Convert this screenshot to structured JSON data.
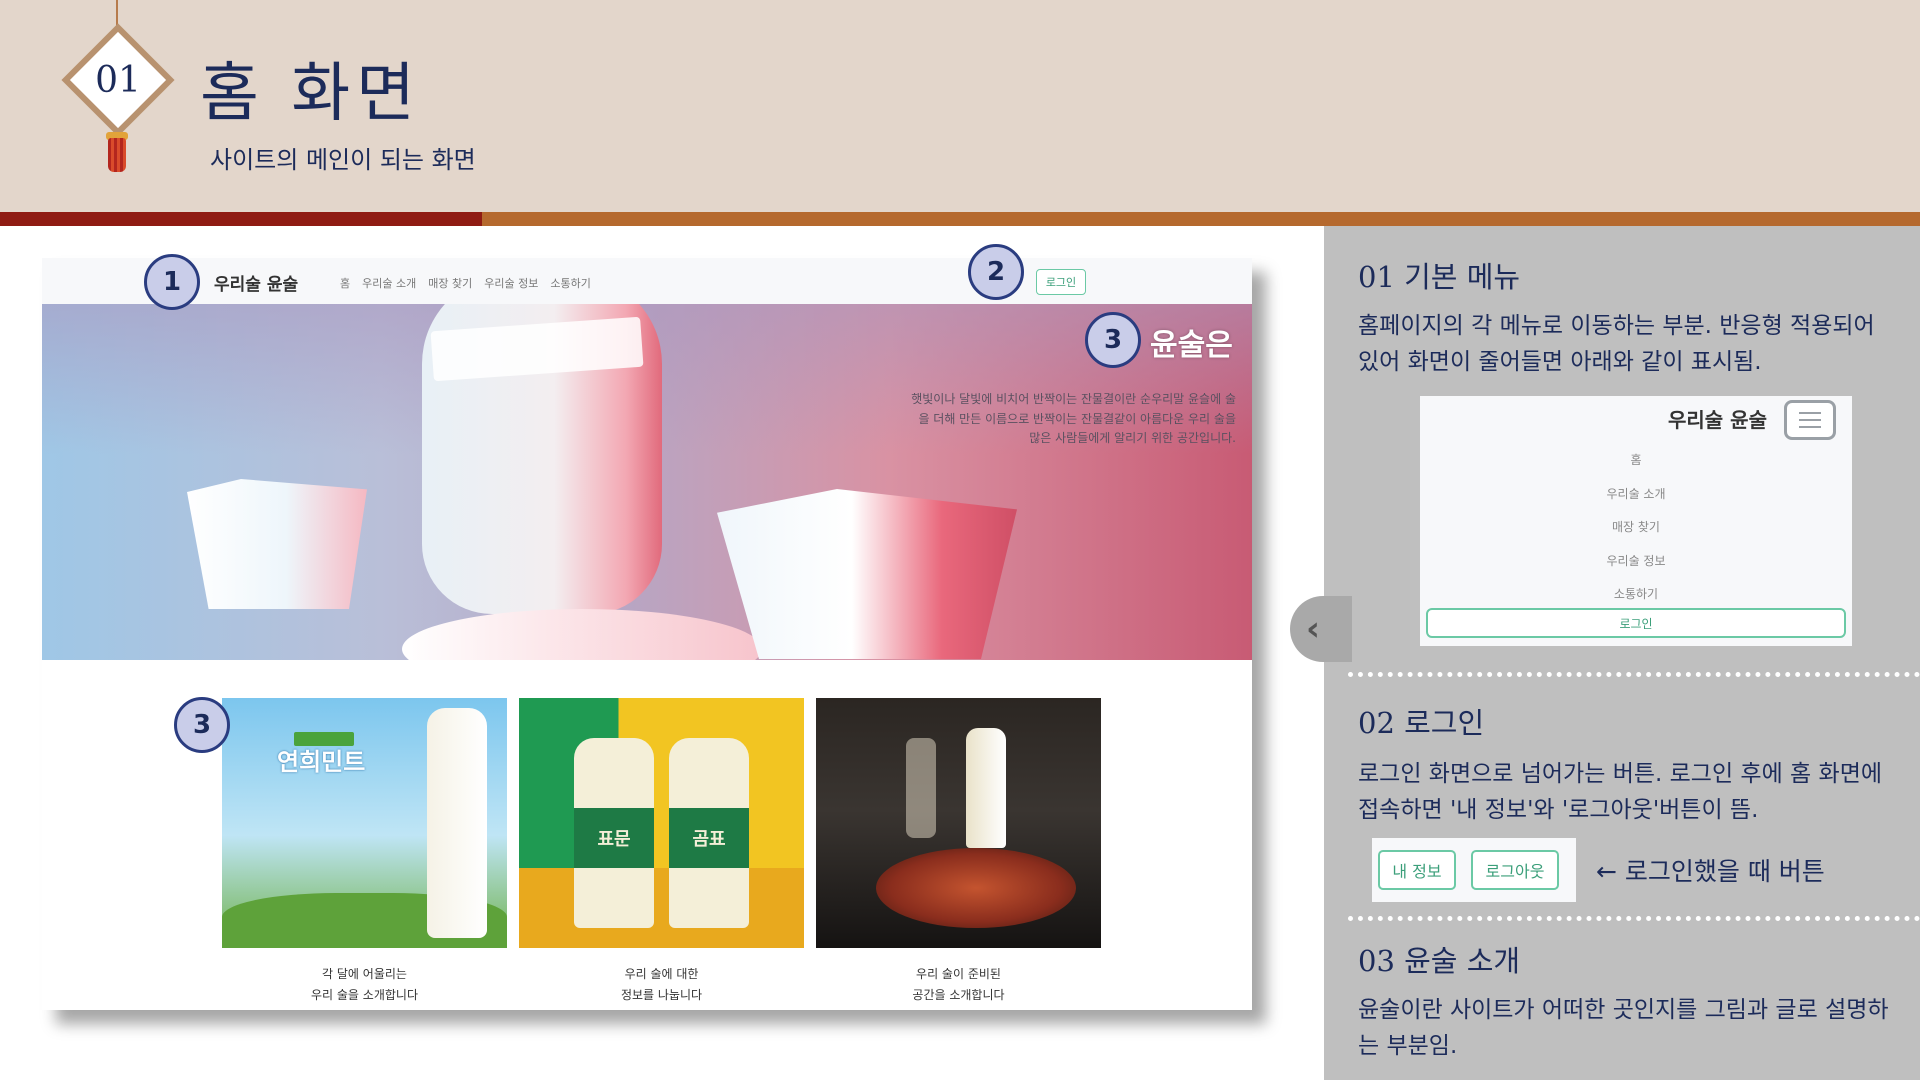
{
  "header": {
    "number": "01",
    "title": "홈 화면",
    "subtitle": "사이트의 메인이 되는 화면"
  },
  "site": {
    "brand": "우리술 윤술",
    "menu": [
      "홈",
      "우리술 소개",
      "매장 찾기",
      "우리술 정보",
      "소통하기"
    ],
    "login": "로그인",
    "hero": {
      "title": "윤술은",
      "desc": "햇빛이나 달빛에 비치어 반짝이는 잔물결이란 순우리말 윤슬에 술을 더해 만든 이름으로 반짝이는 잔물결같이 아름다운 우리 술을 많은 사람들에게 알리기 위한 공간입니다."
    },
    "cards": [
      {
        "image_text": "연희민트",
        "caption_1": "각 달에 어울리는",
        "caption_2": "우리 술을 소개합니다"
      },
      {
        "image_text_1": "표문",
        "image_text_2": "곰표",
        "caption_1": "우리 술에 대한",
        "caption_2": "정보를 나눕니다"
      },
      {
        "caption_1": "우리 술이 준비된",
        "caption_2": "공간을 소개합니다"
      }
    ]
  },
  "markers": [
    "1",
    "2",
    "3",
    "3"
  ],
  "panel": {
    "s1": {
      "head": "01 기본 메뉴",
      "text": "홈페이지의 각 메뉴로 이동하는 부분. 반응형 적용되어 있어 화면이 줄어들면 아래와 같이 표시됨."
    },
    "mobile_menu": {
      "brand": "우리술 윤술",
      "items": [
        "홈",
        "우리술 소개",
        "매장 찾기",
        "우리술 정보",
        "소통하기"
      ],
      "login": "로그인"
    },
    "s2": {
      "head": "02 로그인",
      "text": "로그인 화면으로 넘어가는 버튼. 로그인 후에 홈 화면에 접속하면 '내 정보'와 '로그아웃'버튼이 뜸.",
      "btn_myinfo": "내 정보",
      "btn_logout": "로그아웃",
      "note": "← 로그인했을 때 버튼"
    },
    "s3": {
      "head": "03 윤술 소개",
      "text": "윤술이란 사이트가 어떠한 곳인지를 그림과 글로 설명하는 부분임."
    }
  },
  "colors": {
    "header_bg": "#e3d6cb",
    "accent_red": "#8f1b13",
    "accent_brown": "#b5692e",
    "navy": "#1c2b5a",
    "panel_bg": "#bfbfbf",
    "mint": "#6bc9a5"
  },
  "icons": {
    "diamond": "diamond-badge-icon",
    "tassel": "tassel-icon",
    "hamburger": "hamburger-icon",
    "chevron": "chevron-left-icon"
  }
}
